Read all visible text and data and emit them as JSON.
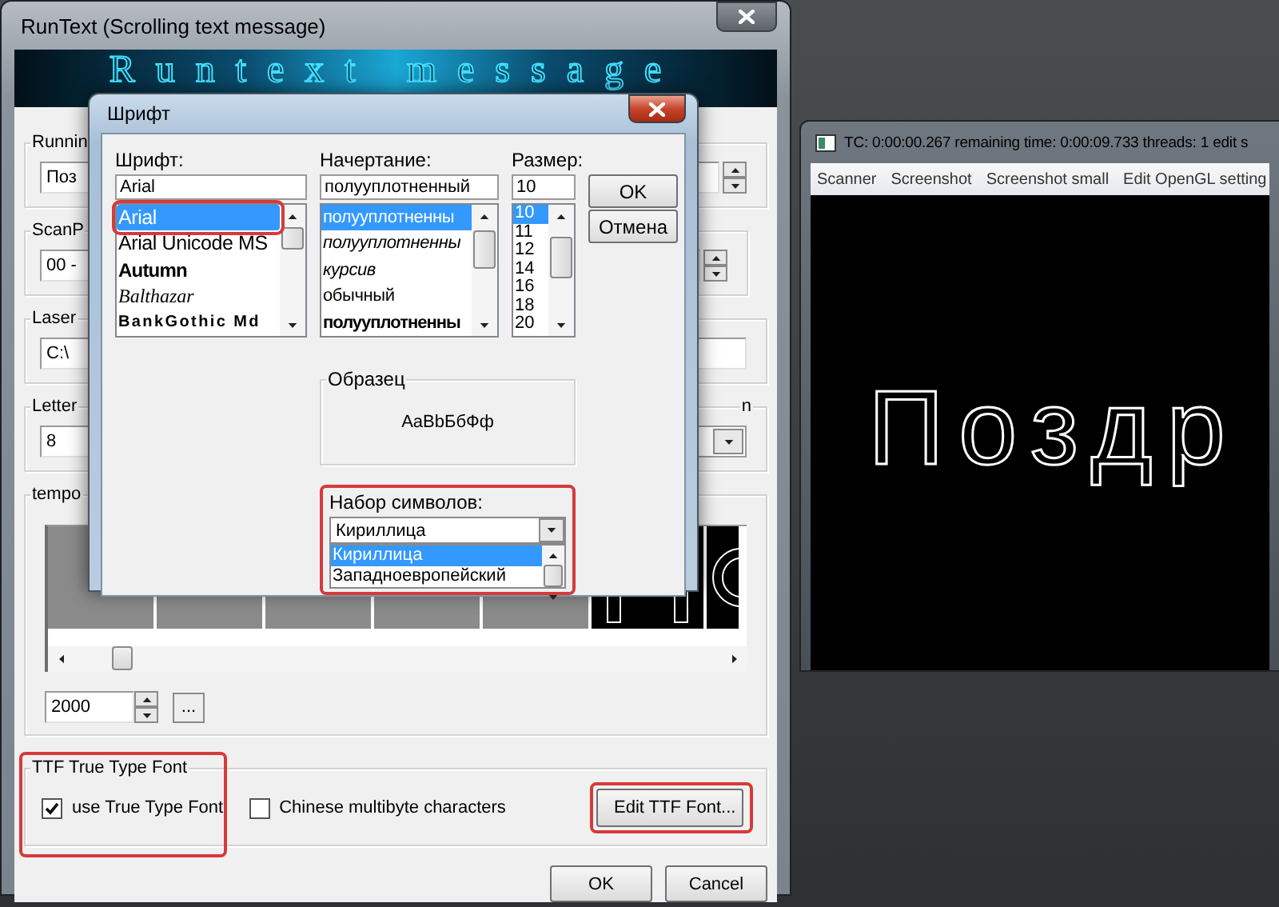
{
  "main_window": {
    "title": "RunText (Scrolling text message)",
    "banner_text": "Runtext message",
    "running": {
      "label": "Runnin",
      "value": "Поз"
    },
    "scan": {
      "label": "ScanP",
      "value": "00 -"
    },
    "laser": {
      "label": "Laser",
      "value": "C:\\"
    },
    "letter": {
      "label": "Letter",
      "value": "8",
      "side_label": "n"
    },
    "tempo": {
      "label": "tempo",
      "interval": "2000",
      "browse_button": "..."
    },
    "ttf": {
      "label": "TTF True Type Font",
      "highlighted": true,
      "options": [
        {
          "label": "use True Type Font",
          "checked": true
        },
        {
          "label": "Chinese multibyte characters",
          "checked": false
        }
      ],
      "edit_button": {
        "label": "Edit TTF Font...",
        "highlighted": true
      }
    },
    "buttons": [
      "OK",
      "Cancel"
    ]
  },
  "font_dialog": {
    "title": "Шрифт",
    "font": {
      "label": "Шрифт:",
      "value": "Arial",
      "items": [
        {
          "label": "Arial",
          "kind": "regular",
          "selected": true,
          "highlighted": true
        },
        {
          "label": "Arial Unicode MS",
          "kind": "regular",
          "selected": false,
          "highlighted": false
        },
        {
          "label": "Autumn",
          "kind": "heavy",
          "selected": false,
          "highlighted": false
        },
        {
          "label": "Balthazar",
          "kind": "script",
          "selected": false,
          "highlighted": false
        },
        {
          "label": "BankGothic Md",
          "kind": "wide",
          "selected": false,
          "highlighted": false
        }
      ]
    },
    "style": {
      "label": "Начертание:",
      "value": "полууплотненный",
      "items": [
        {
          "label": "полууплотненны",
          "kind": "regular",
          "selected": true
        },
        {
          "label": "полууплотненны",
          "kind": "italic",
          "selected": false
        },
        {
          "label": "курсив",
          "kind": "italic",
          "selected": false
        },
        {
          "label": "обычный",
          "kind": "regular",
          "selected": false
        },
        {
          "label": "полууплотненны",
          "kind": "bold",
          "selected": false
        }
      ]
    },
    "size": {
      "label": "Размер:",
      "value": "10",
      "items": [
        {
          "label": "10",
          "selected": true
        },
        {
          "label": "11",
          "selected": false
        },
        {
          "label": "12",
          "selected": false
        },
        {
          "label": "14",
          "selected": false
        },
        {
          "label": "16",
          "selected": false
        },
        {
          "label": "18",
          "selected": false
        },
        {
          "label": "20",
          "selected": false
        }
      ]
    },
    "buttons": [
      "OK",
      "Отмена"
    ],
    "sample": {
      "label": "Образец",
      "text": "AaBbБбФф"
    },
    "charset": {
      "label": "Набор символов:",
      "value": "Кириллица",
      "highlighted": true,
      "options": [
        {
          "label": "Кириллица",
          "selected": true
        },
        {
          "label": "Западноевропейский",
          "selected": false
        }
      ]
    }
  },
  "preview_window": {
    "title": "TC: 0:00:00.267 remaining time: 0:00:09.733 threads: 1 edit s",
    "menu": [
      "Scanner",
      "Screenshot",
      "Screenshot small",
      "Edit OpenGL setting"
    ],
    "display_text": "Поздр"
  }
}
